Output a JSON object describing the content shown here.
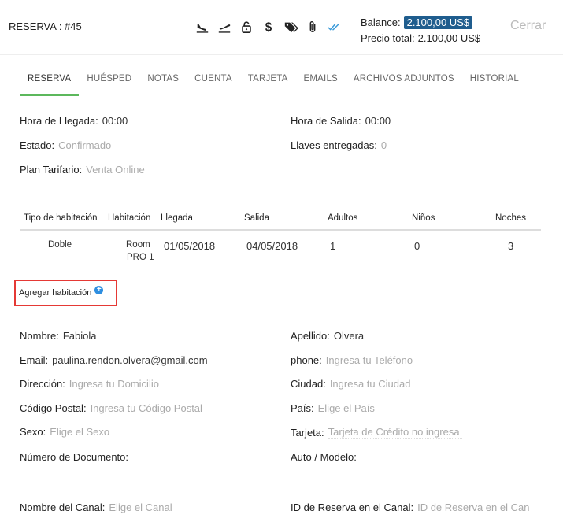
{
  "header": {
    "title": "RESERVA : #45",
    "balance_label": "Balance:",
    "balance_value": "2.100,00 US$",
    "total_label": "Precio total:",
    "total_value": "2.100,00 US$",
    "close_label": "Cerrar",
    "icons": [
      "plane-arrival-icon",
      "plane-departure-icon",
      "lock-icon",
      "dollar-icon",
      "tags-icon",
      "paperclip-icon",
      "double-check-icon"
    ]
  },
  "tabs": [
    "RESERVA",
    "HUÉSPED",
    "NOTAS",
    "CUENTA",
    "TARJETA",
    "EMAILS",
    "ARCHIVOS ADJUNTOS",
    "HISTORIAL"
  ],
  "booking": {
    "arrival_label": "Hora de Llegada:",
    "arrival_value": "00:00",
    "departure_label": "Hora de Salida:",
    "departure_value": "00:00",
    "status_label": "Estado:",
    "status_value": "Confirmado",
    "keys_label": "Llaves entregadas:",
    "keys_value": "0",
    "rate_label": "Plan Tarifario:",
    "rate_value": "Venta Online"
  },
  "rooms": {
    "headers": [
      "Tipo de habitación",
      "Habitación",
      "Llegada",
      "Salida",
      "Adultos",
      "Niños",
      "Noches"
    ],
    "rows": [
      {
        "type": "Doble",
        "room_line1": "Room",
        "room_line2": "PRO 1",
        "arrival": "01/05/2018",
        "departure": "04/05/2018",
        "adults": "1",
        "children": "0",
        "nights": "3"
      }
    ],
    "add_label": "Agregar habitación"
  },
  "guest": {
    "name_label": "Nombre:",
    "name_value": "Fabiola",
    "lastname_label": "Apellido:",
    "lastname_value": "Olvera",
    "email_label": "Email:",
    "email_value": "paulina.rendon.olvera@gmail.com",
    "phone_label": "phone:",
    "phone_placeholder": "Ingresa tu Teléfono",
    "address_label": "Dirección:",
    "address_placeholder": "Ingresa tu Domicilio",
    "city_label": "Ciudad:",
    "city_placeholder": "Ingresa tu Ciudad",
    "zip_label": "Código Postal:",
    "zip_placeholder": "Ingresa tu Código Postal",
    "country_label": "País:",
    "country_placeholder": "Elige el País",
    "sex_label": "Sexo:",
    "sex_placeholder": "Elige el Sexo",
    "card_label": "Tarjeta:",
    "card_placeholder": "Tarjeta de Crédito no ingresa",
    "doc_label": "Número de Documento:",
    "car_label": "Auto / Modelo:",
    "channel_label": "Nombre del Canal:",
    "channel_placeholder": "Elige el Canal",
    "channel_res_label": "ID de Reserva en el Canal:",
    "channel_res_placeholder": "ID de Reserva en el Can"
  }
}
